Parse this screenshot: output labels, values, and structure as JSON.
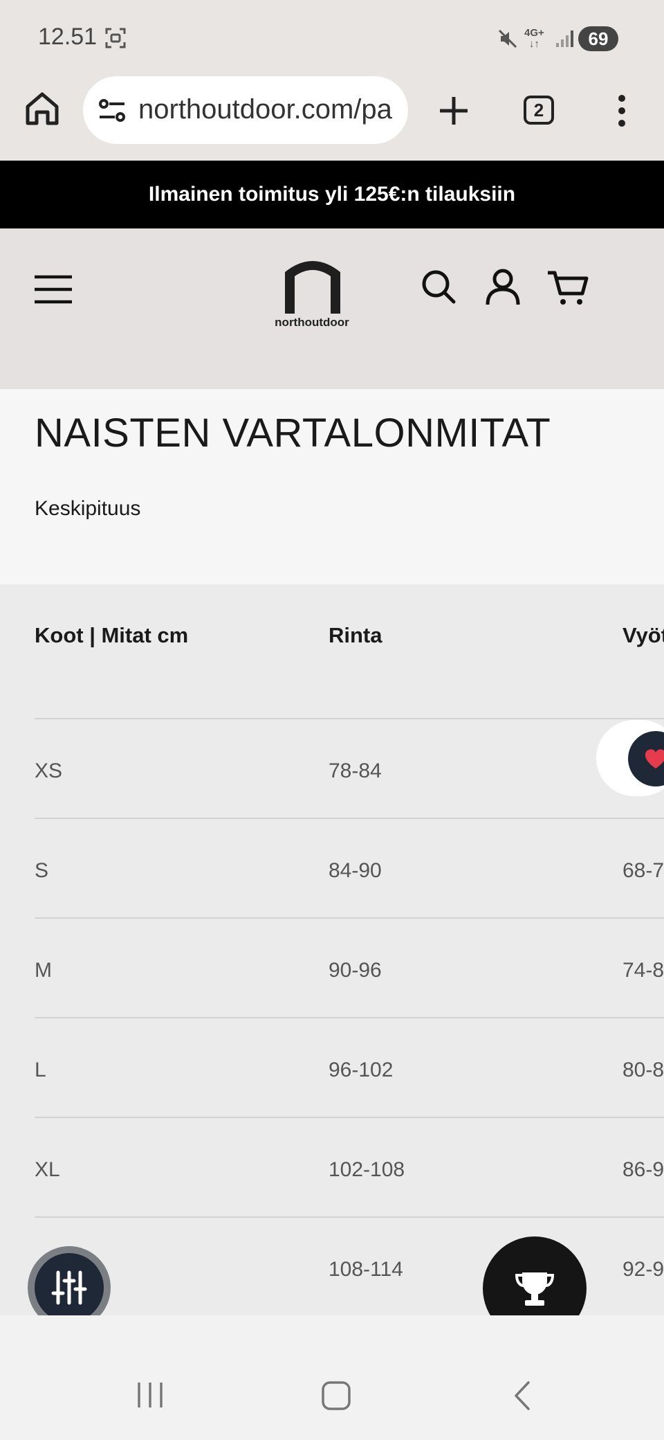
{
  "status_bar": {
    "time": "12.51",
    "network": "4G+",
    "battery": "69"
  },
  "browser": {
    "url": "northoutdoor.com/pa",
    "tab_count": "2"
  },
  "promo": {
    "text": "Ilmainen toimitus yli 125€:n tilauksiin"
  },
  "header": {
    "logo_text": "northoutdoor"
  },
  "page": {
    "title": "NAISTEN VARTALONMITAT",
    "subtitle": "Keskipituus"
  },
  "table": {
    "headers": [
      "Koot | Mitat cm",
      "Rinta",
      "Vyöt"
    ],
    "rows": [
      {
        "size": "XS",
        "chest": "78-84",
        "waist": ""
      },
      {
        "size": "S",
        "chest": "84-90",
        "waist": "68-7"
      },
      {
        "size": "M",
        "chest": "90-96",
        "waist": "74-8"
      },
      {
        "size": "L",
        "chest": "96-102",
        "waist": "80-8"
      },
      {
        "size": "XL",
        "chest": "102-108",
        "waist": "86-9"
      },
      {
        "size": "",
        "chest": "108-114",
        "waist": "92-9"
      }
    ]
  },
  "colors": {
    "promo_bg": "#000000",
    "accent_dark": "#1f2836",
    "heart": "#e63a4d"
  }
}
